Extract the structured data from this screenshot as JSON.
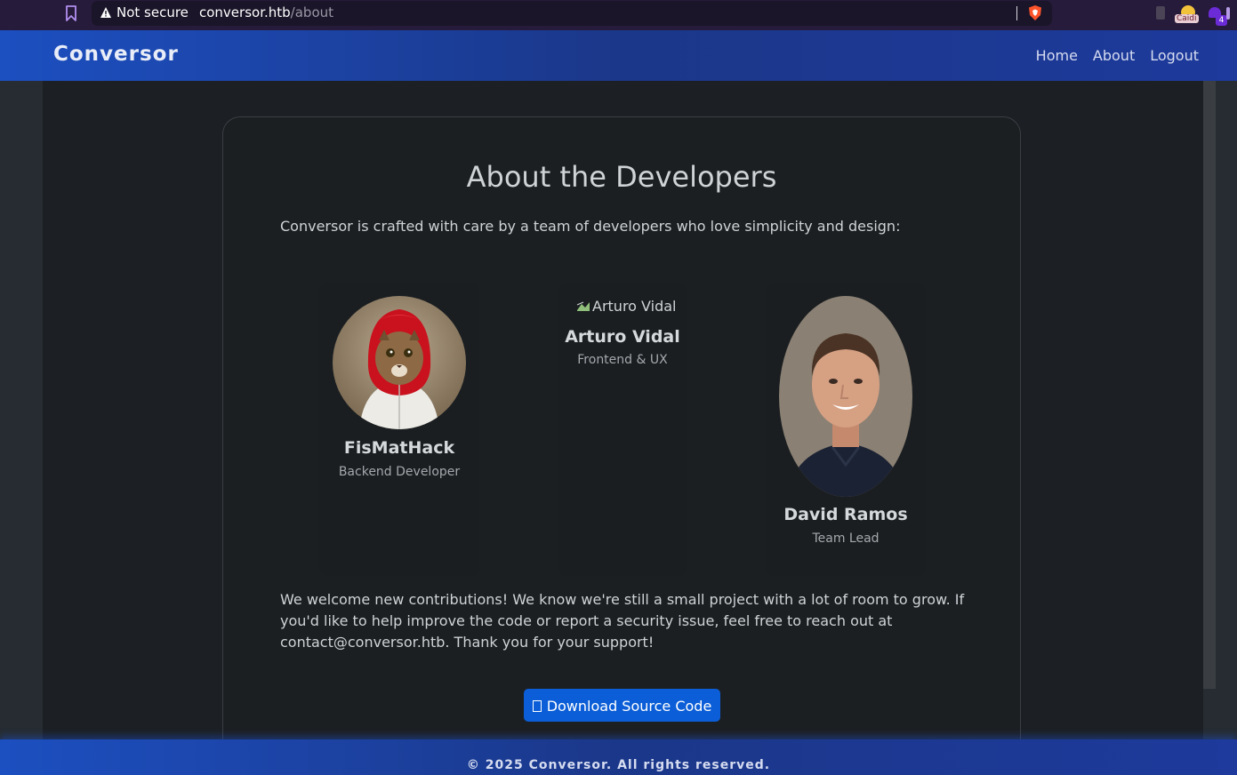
{
  "browser": {
    "security_label": "Not secure",
    "url_host": "conversor.htb",
    "url_path": "/about",
    "extension_label": "Caidi",
    "extension_badge": "4"
  },
  "navbar": {
    "brand": "Conversor",
    "links": [
      {
        "label": "Home"
      },
      {
        "label": "About"
      },
      {
        "label": "Logout"
      }
    ]
  },
  "content": {
    "title": "About the Developers",
    "intro": "Conversor is crafted with care by a team of developers who love simplicity and design:",
    "developers": [
      {
        "name": "FisMatHack",
        "role": "Backend Developer",
        "image": "cat-in-red-hoodie"
      },
      {
        "name": "Arturo Vidal",
        "role": "Frontend & UX",
        "image_alt": "Arturo Vidal"
      },
      {
        "name": "David Ramos",
        "role": "Team Lead",
        "image": "man-portrait"
      }
    ],
    "outro": "We welcome new contributions! We know we're still a small project with a lot of room to grow. If you'd like to help improve the code or report a security issue, feel free to reach out at contact@conversor.htb. Thank you for your support!",
    "download_label": "Download Source Code"
  },
  "footer": {
    "text": "© 2025 Conversor. All rights reserved."
  },
  "colors": {
    "accent": "#0b5ed7",
    "navbar": "#1b3789",
    "background": "#1c2024"
  }
}
